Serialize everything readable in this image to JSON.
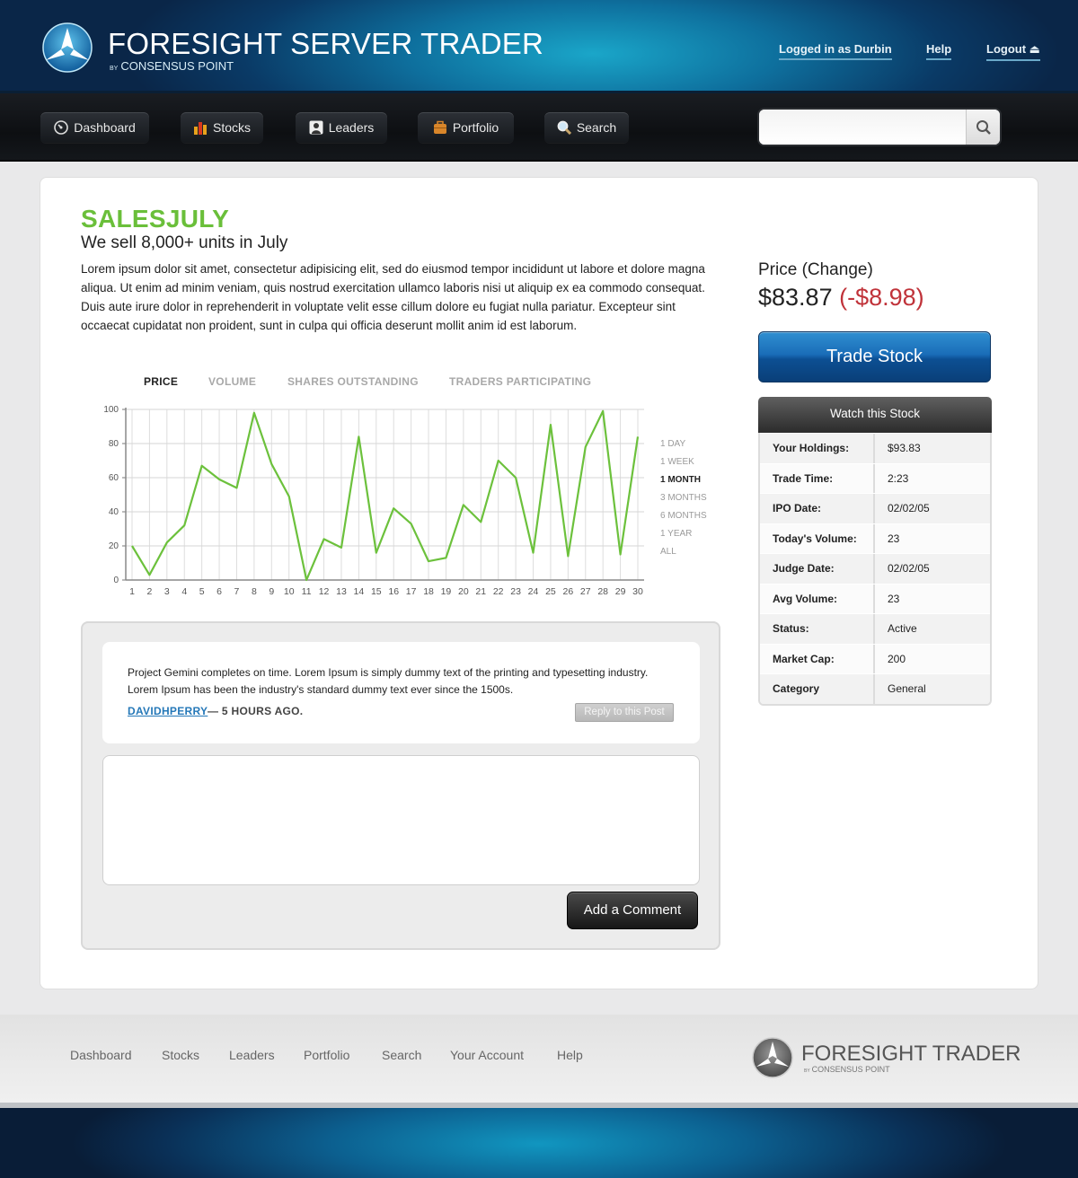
{
  "header": {
    "title": "FORESIGHT SERVER TRADER",
    "subtitle_by": "BY",
    "subtitle": "CONSENSUS POINT",
    "links": {
      "logged_in": "Logged in as Durbin",
      "help": "Help",
      "logout": "Logout ⏏"
    }
  },
  "nav": {
    "items": [
      {
        "label": "Dashboard",
        "icon": "dashboard-icon"
      },
      {
        "label": "Stocks",
        "icon": "bar-chart-icon"
      },
      {
        "label": "Leaders",
        "icon": "user-icon"
      },
      {
        "label": "Portfolio",
        "icon": "briefcase-icon"
      },
      {
        "label": "Search",
        "icon": "magnifier-icon"
      }
    ],
    "search_placeholder": ""
  },
  "stock": {
    "symbol": "SALESJULY",
    "subtitle": "We sell 8,000+ units in July",
    "description": "Lorem ipsum dolor sit amet, consectetur adipisicing elit, sed do eiusmod tempor incididunt ut labore et dolore magna aliqua. Ut enim ad minim veniam, quis nostrud exercitation ullamco laboris nisi ut aliquip ex ea commodo consequat. Duis aute irure dolor in reprehenderit in voluptate velit esse cillum dolore eu fugiat nulla pariatur. Excepteur sint occaecat cupidatat non proident, sunt in culpa qui officia deserunt mollit anim id est laborum."
  },
  "chart_tabs": [
    "PRICE",
    "VOLUME",
    "SHARES OUTSTANDING",
    "TRADERS PARTICIPATING"
  ],
  "range_options": [
    "1 DAY",
    "1 WEEK",
    "1 MONTH",
    "3 MONTHS",
    "6 MONTHS",
    "1 YEAR",
    "ALL"
  ],
  "range_selected": "1 MONTH",
  "chart_data": {
    "type": "line",
    "title": "",
    "xlabel": "",
    "ylabel": "",
    "x": [
      1,
      2,
      3,
      4,
      5,
      6,
      7,
      8,
      9,
      10,
      11,
      12,
      13,
      14,
      15,
      16,
      17,
      18,
      19,
      20,
      21,
      22,
      23,
      24,
      25,
      26,
      27,
      28,
      29,
      30
    ],
    "series": [
      {
        "values": [
          20,
          3,
          22,
          32,
          67,
          59,
          54,
          98,
          68,
          49,
          0,
          24,
          19,
          84,
          16,
          42,
          33,
          11,
          13,
          44,
          34,
          70,
          60,
          16,
          91,
          14,
          78,
          99,
          15,
          84
        ]
      }
    ],
    "ylim": [
      0,
      100
    ],
    "yticks": [
      0,
      20,
      40,
      60,
      80,
      100
    ],
    "grid": true,
    "line_color": "#6cc13c"
  },
  "post": {
    "text": "Project Gemini completes on time. Lorem Ipsum is simply dummy text of the printing and typesetting industry. Lorem Ipsum has been the industry's standard dummy text ever since the 1500s.",
    "author": "DAVIDHPERRY",
    "time": "— 5 HOURS AGO.",
    "reply_label": "Reply to this Post"
  },
  "comment": {
    "placeholder": "",
    "button_label": "Add a Comment"
  },
  "price": {
    "label": "Price (Change)",
    "value": "$83.87",
    "change": "(-$8.98)"
  },
  "trade_button": "Trade Stock",
  "watch_button": "Watch this Stock",
  "details": [
    {
      "key": "Your Holdings:",
      "value": "$93.83"
    },
    {
      "key": "Trade Time:",
      "value": "2:23"
    },
    {
      "key": "IPO Date:",
      "value": "02/02/05"
    },
    {
      "key": "Today's Volume:",
      "value": "23"
    },
    {
      "key": "Judge Date:",
      "value": "02/02/05"
    },
    {
      "key": "Avg Volume:",
      "value": "23"
    },
    {
      "key": "Status:",
      "value": "Active"
    },
    {
      "key": "Market Cap:",
      "value": "200"
    },
    {
      "key": "Category",
      "value": "General"
    }
  ],
  "footer": {
    "links": [
      "Dashboard",
      "Stocks",
      "Leaders",
      "Portfolio",
      "Search",
      "Your Account",
      "Help"
    ],
    "logo_title": "FORESIGHT TRADER",
    "logo_by": "BY",
    "logo_sub": "CONSENSUS POINT"
  },
  "colors": {
    "accent_green": "#6abf3a",
    "change_red": "#c0333a",
    "link_blue": "#2578b8"
  }
}
